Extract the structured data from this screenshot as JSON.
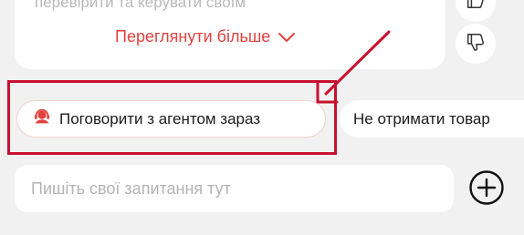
{
  "message": {
    "cut_text": "перевірити та керувати своїм",
    "see_more_label": "Переглянути більше",
    "see_more_icon": "chevron-down-icon"
  },
  "feedback": {
    "like_icon": "thumbs-up-icon",
    "dislike_icon": "thumbs-down-icon"
  },
  "quick_replies": [
    {
      "label": "Поговорити з агентом зараз",
      "icon": "agent-headset-icon"
    },
    {
      "label": "Не отримати товар"
    }
  ],
  "composer": {
    "placeholder": "Пишіть свої запитання тут",
    "add_icon": "plus-circle-icon"
  },
  "colors": {
    "accent": "#e0423f",
    "annotation": "#c8102e",
    "background": "#f1f1f1"
  }
}
